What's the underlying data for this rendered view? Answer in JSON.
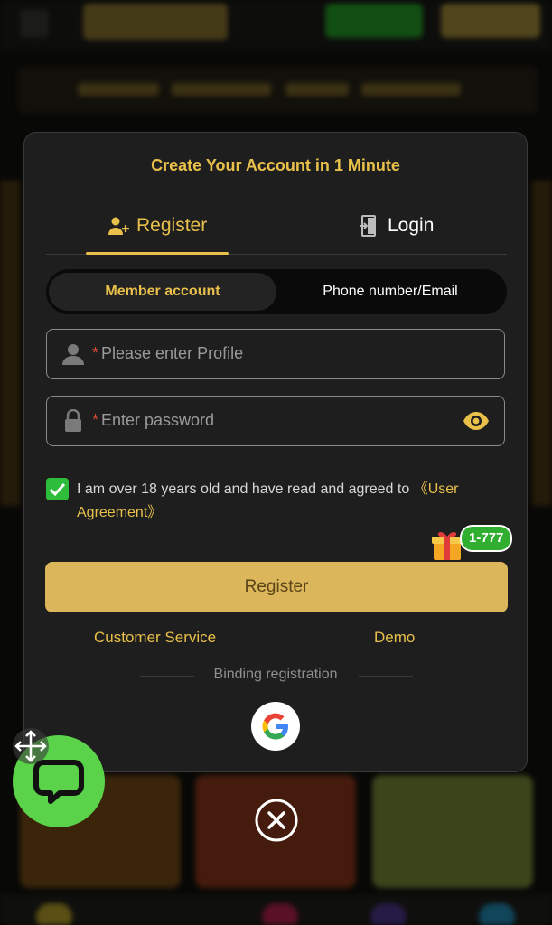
{
  "modal": {
    "title": "Create Your Account in 1 Minute",
    "tabs": [
      {
        "label": "Register",
        "active": true,
        "icon": "user-add-icon"
      },
      {
        "label": "Login",
        "active": false,
        "icon": "login-door-icon"
      }
    ],
    "segments": [
      {
        "label": "Member account",
        "active": true
      },
      {
        "label": "Phone number/Email",
        "active": false
      }
    ],
    "fields": {
      "profile": {
        "required_mark": "*",
        "placeholder": "Please enter Profile",
        "icon": "user-icon"
      },
      "password": {
        "required_mark": "*",
        "placeholder": "Enter password",
        "icon": "lock-icon",
        "toggle_icon": "eye-icon"
      }
    },
    "agreement": {
      "checked": true,
      "text": "I am over 18 years old and have read and agreed to ",
      "link_text": "《User Agreement》"
    },
    "promo_badge": "1-777",
    "register_button": "Register",
    "links": {
      "customer_service": "Customer Service",
      "demo": "Demo"
    },
    "binding_label": "Binding registration"
  },
  "colors": {
    "accent": "#e8c04a",
    "button": "#dcb65a",
    "success": "#2ebd3a",
    "modal_bg": "#1e1e1e"
  }
}
